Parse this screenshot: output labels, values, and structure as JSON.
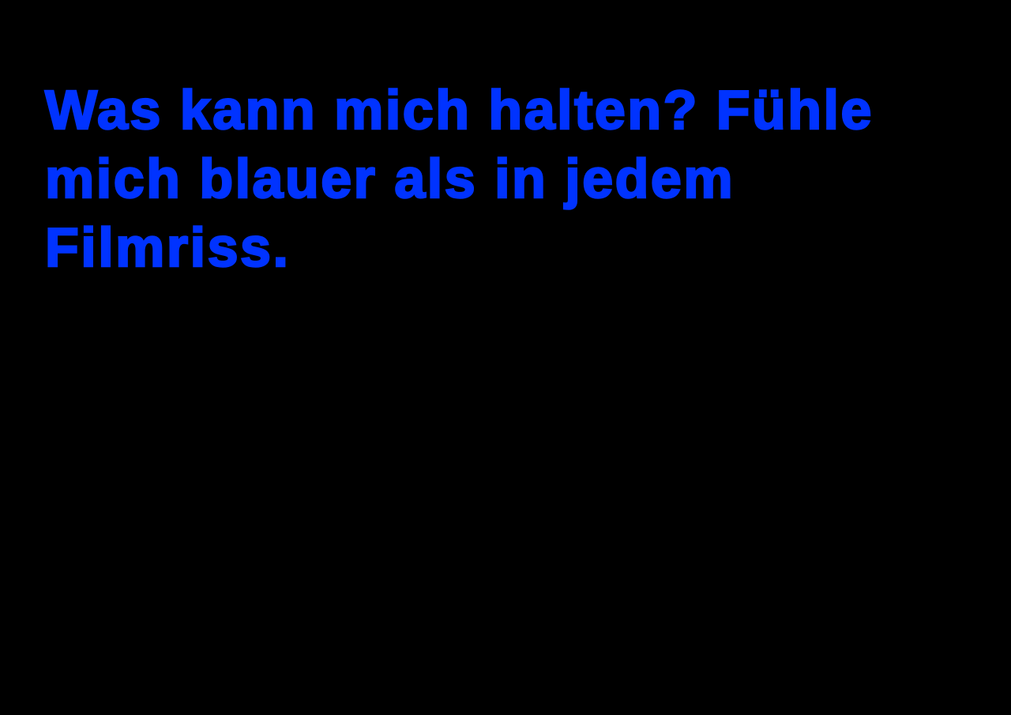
{
  "text": {
    "lines": [
      "Was kann mich halten? Fühle",
      "mich blauer als in jedem",
      "Filmriss."
    ]
  },
  "colors": {
    "background": "#000000",
    "text": "#0033ff"
  }
}
